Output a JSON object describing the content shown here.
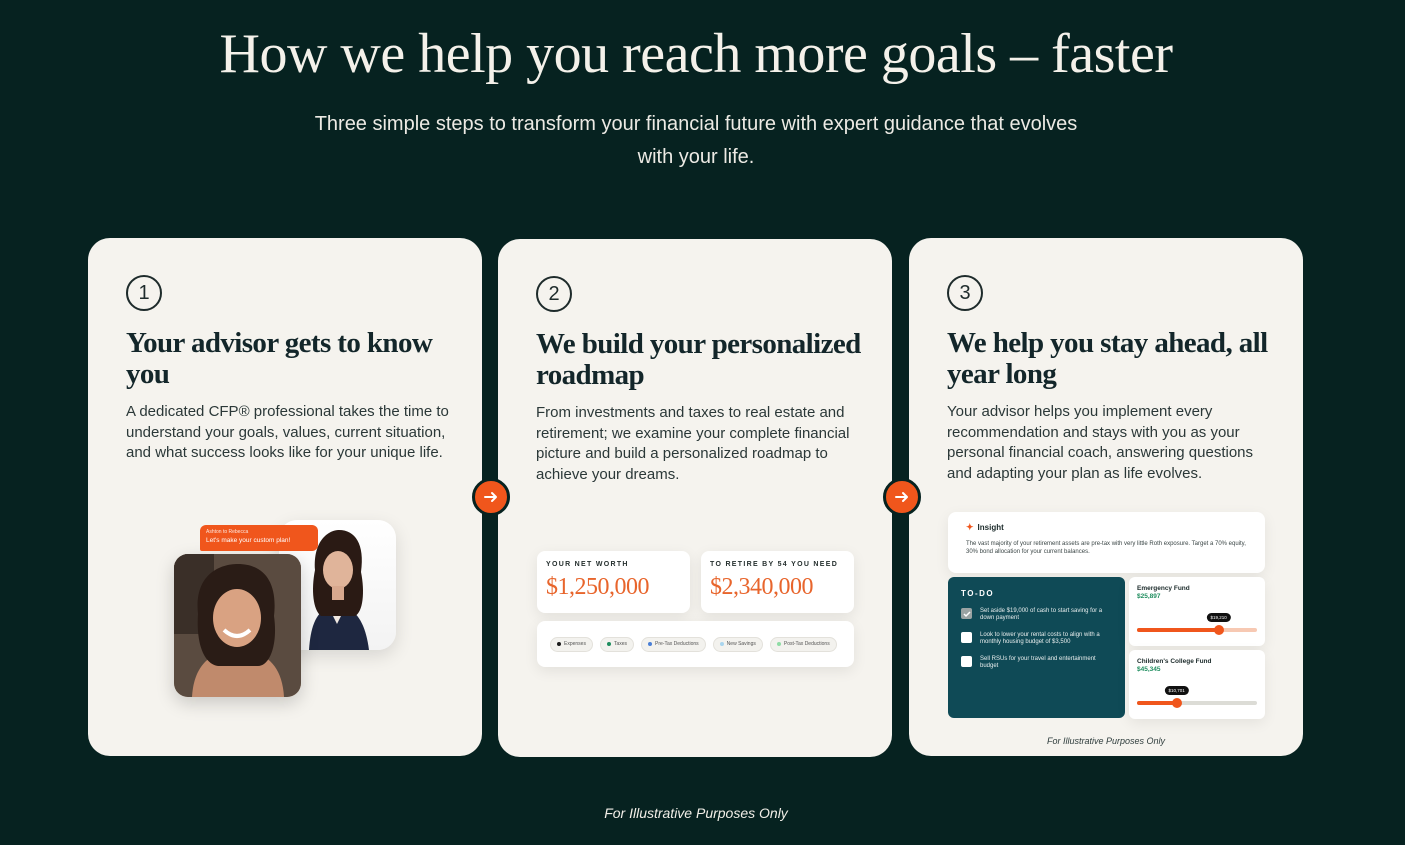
{
  "hero": {
    "title": "How we help you reach more goals – faster",
    "subtitle": "Three simple steps to transform your financial future with expert guidance that evolves with your life."
  },
  "steps": [
    {
      "number": "1",
      "title": "Your advisor gets to know you",
      "body": "A dedicated CFP® professional takes the time to understand your goals, values, current situation, and what success looks like for your unique life.",
      "bubble": {
        "from": "Ashton to Rebecca",
        "message": "Let's make your custom plan!"
      }
    },
    {
      "number": "2",
      "title": "We build your personalized roadmap",
      "body": "From investments and taxes to real estate and retirement; we examine your complete financial picture and build a personalized roadmap to achieve your dreams.",
      "net_worth_label": "YOUR NET WORTH",
      "net_worth_value": "$1,250,000",
      "retire_label": "TO RETIRE BY 54 YOU NEED",
      "retire_value": "$2,340,000",
      "legend": [
        {
          "label": "Expenses",
          "color": "#1b1b1b"
        },
        {
          "label": "Taxes",
          "color": "#1e8d5e"
        },
        {
          "label": "Pre-Tax Deductions",
          "color": "#4a7fd6"
        },
        {
          "label": "New Savings",
          "color": "#a9d5ee"
        },
        {
          "label": "Post-Tax Deductions",
          "color": "#8fdca5"
        }
      ]
    },
    {
      "number": "3",
      "title": "We help you stay ahead, all year long",
      "body": "Your advisor helps you implement every recommendation and stays with you as your personal financial coach, answering questions and adapting your plan as life evolves.",
      "insight_title": "Insight",
      "insight_text": "The vast majority of your retirement assets are pre-tax with very little Roth exposure. Target a 70% equity, 30% bond allocation for your current balances.",
      "todo_title": "TO-DO",
      "todos": [
        {
          "text": "Set aside $19,000 of cash to start saving for a down payment",
          "done": true
        },
        {
          "text": "Look to lower your rental costs to align with a monthly housing budget of $3,500",
          "done": false
        },
        {
          "text": "Sell RSUs for your travel and entertainment budget",
          "done": false
        }
      ],
      "funds": [
        {
          "name": "Emergency Fund",
          "value": "$25,897",
          "tip": "$19,210",
          "progress": 0.68
        },
        {
          "name": "Children's College Fund",
          "value": "$45,345",
          "tip": "$10,701",
          "progress": 0.33
        }
      ],
      "footnote": "For Illustrative Purposes Only"
    }
  ],
  "footnote": "For Illustrative Purposes Only",
  "colors": {
    "background": "#062220",
    "card": "#f5f3ee",
    "accent": "#f0561c",
    "todo_panel": "#0f4a56"
  },
  "icons": {
    "arrow": "arrow-right-icon",
    "insight": "sparkle-icon",
    "check": "check-icon"
  }
}
